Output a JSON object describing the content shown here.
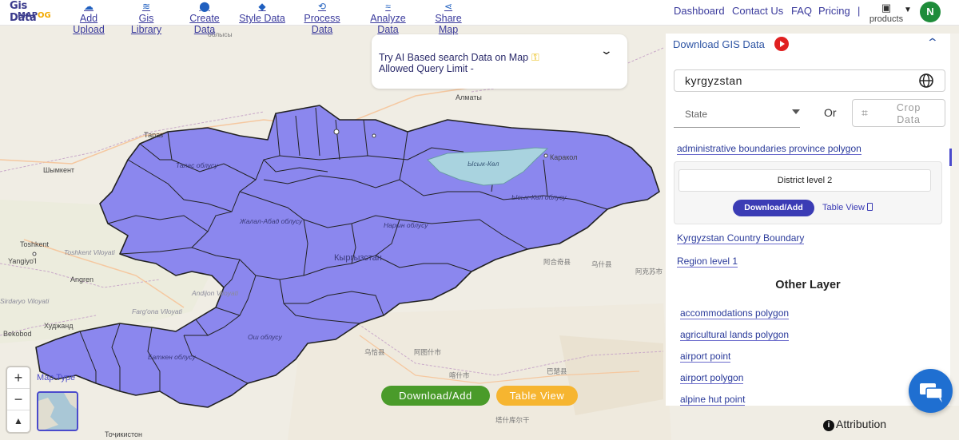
{
  "logo": {
    "line1": "Gis Data",
    "line2a": "MAP",
    "line2b": "OG"
  },
  "nav": [
    {
      "label": "Add Upload",
      "icon": "cloud-upload-icon"
    },
    {
      "label": "Gis Library",
      "icon": "layers-icon"
    },
    {
      "label": "Create Data",
      "icon": "map-pin-icon"
    },
    {
      "label": "Style Data",
      "icon": "paint-bucket-icon"
    },
    {
      "label": "Process Data",
      "icon": "process-icon"
    },
    {
      "label": "Analyze Data",
      "icon": "analyze-icon"
    },
    {
      "label": "Share Map",
      "icon": "share-icon"
    }
  ],
  "nav_right": {
    "dashboard": "Dashboard",
    "contact": "Contact Us",
    "faq": "FAQ",
    "pricing": "Pricing",
    "separator": "|",
    "products": "products",
    "avatar": "N"
  },
  "ai_search": {
    "line1": "Try AI Based search Data on Map",
    "line2": "Allowed Query Limit -"
  },
  "map": {
    "region_label": "Кыргызстан",
    "labels": {
      "almaty": "Алматы",
      "taraz": "Тараз",
      "shymkent": "Шымкент",
      "toshkent": "Toshkent",
      "tashkent_viloyati": "Toshkent Viloyati",
      "yangiyol": "Yangiyo'l",
      "angren": "Angren",
      "sirdaryo": "Sirdaryo Viloyati",
      "fargona": "Farg'ona Viloyati",
      "andijon": "Andijon Viloyati",
      "khujand": "Худжанд",
      "bekobod": "Bekobod",
      "tochikiston": "Тоҷикистон",
      "talas_oblast": "Талас облусу",
      "jalal_abad": "Жалал-Абад облусу",
      "naryn": "Нарын облусу",
      "issyk_kul": "Ысык-Көл облусу",
      "issyk_lake": "Ысык-Көл",
      "osh": "Ош облусу",
      "batken": "Баткен облусу",
      "karakol": "Каракол",
      "kashgar_cn": "阿图什市",
      "ulugqat": "乌恰县",
      "kashgar": "喀什市",
      "akqi": "阿合奇县",
      "wushi": "乌什县",
      "aksu": "阿克苏市",
      "tashkurgan": "塔什库尔干",
      "bachu": "巴楚县",
      "obl_kz": "облысы"
    }
  },
  "controls": {
    "zoom_in": "+",
    "zoom_out": "−",
    "reset": "▲",
    "map_type": "Map Type"
  },
  "actions": {
    "download": "Download/Add",
    "table_view": "Table View"
  },
  "attribution": "Attribution",
  "panel": {
    "title": "Download GIS Data",
    "country": "kyrgyzstan",
    "state_placeholder": "State",
    "or": "Or",
    "crop": "Crop Data",
    "top_link": "administrative boundaries province polygon",
    "card": {
      "level": "District level 2",
      "download": "Download/Add",
      "table_view": "Table View"
    },
    "links": [
      "Kyrgyzstan Country Boundary",
      "Region level 1"
    ],
    "other_layer_title": "Other Layer",
    "other_layers": [
      "accommodations polygon",
      "agricultural lands polygon",
      "airport point",
      "airport polygon",
      "alpine hut point"
    ]
  },
  "colors": {
    "region_fill": "#8b87ee",
    "lake": "#a9d3df",
    "brand": "#3a3a9c",
    "download": "#4a9b2a",
    "table": "#f6b530"
  }
}
